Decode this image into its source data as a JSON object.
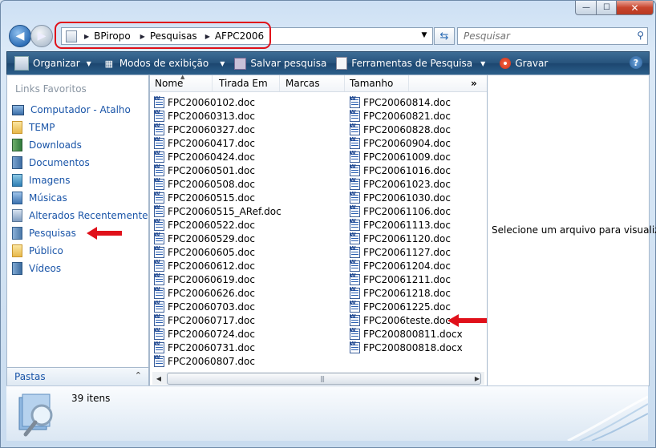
{
  "window": {
    "minimize_label": "—",
    "maximize_label": "☐",
    "close_label": "✕"
  },
  "address": {
    "crumbs": [
      "BPiropo",
      "Pesquisas",
      "AFPC2006"
    ]
  },
  "search": {
    "placeholder": "Pesquisar"
  },
  "toolbar": {
    "items": [
      {
        "label": "Organizar",
        "icon": "organize-icon",
        "has_dropdown": true
      },
      {
        "label": "Modos de exibição",
        "icon": "views-icon",
        "has_dropdown": true
      },
      {
        "label": "Salvar pesquisa",
        "icon": "save-icon",
        "has_dropdown": false
      },
      {
        "label": "Ferramentas de Pesquisa",
        "icon": "search-tools-icon",
        "has_dropdown": true
      },
      {
        "label": "Gravar",
        "icon": "burn-icon",
        "has_dropdown": false
      }
    ],
    "help_label": "?"
  },
  "nav": {
    "title": "Links Favoritos",
    "links": [
      {
        "label": "Computador - Atalho",
        "icon": "computer-icon"
      },
      {
        "label": "TEMP",
        "icon": "folder-icon"
      },
      {
        "label": "Downloads",
        "icon": "downloads-icon"
      },
      {
        "label": "Documentos",
        "icon": "documents-icon"
      },
      {
        "label": "Imagens",
        "icon": "pictures-icon"
      },
      {
        "label": "Músicas",
        "icon": "music-icon"
      },
      {
        "label": "Alterados Recentemente",
        "icon": "recent-icon"
      },
      {
        "label": "Pesquisas",
        "icon": "searches-icon"
      },
      {
        "label": "Público",
        "icon": "folder-icon"
      },
      {
        "label": "Vídeos",
        "icon": "videos-icon"
      }
    ],
    "folders_label": "Pastas",
    "folders_chevron": "⌃"
  },
  "columns": [
    "Nome",
    "Tirada Em",
    "Marcas",
    "Tamanho"
  ],
  "more_columns": "»",
  "files_col1": [
    "FPC20060102.doc",
    "FPC20060313.doc",
    "FPC20060327.doc",
    "FPC20060417.doc",
    "FPC20060424.doc",
    "FPC20060501.doc",
    "FPC20060508.doc",
    "FPC20060515.doc",
    "FPC20060515_ARef.doc",
    "FPC20060522.doc",
    "FPC20060529.doc",
    "FPC20060605.doc",
    "FPC20060612.doc",
    "FPC20060619.doc",
    "FPC20060626.doc",
    "FPC20060703.doc",
    "FPC20060717.doc",
    "FPC20060724.doc",
    "FPC20060731.doc",
    "FPC20060807.doc"
  ],
  "files_col2": [
    "FPC20060814.doc",
    "FPC20060821.doc",
    "FPC20060828.doc",
    "FPC20060904.doc",
    "FPC20061009.doc",
    "FPC20061016.doc",
    "FPC20061023.doc",
    "FPC20061030.doc",
    "FPC20061106.doc",
    "FPC20061113.doc",
    "FPC20061120.doc",
    "FPC20061127.doc",
    "FPC20061204.doc",
    "FPC20061211.doc",
    "FPC20061218.doc",
    "FPC20061225.doc",
    "FPC2006teste.doc",
    "FPC200800811.docx",
    "FPC200800818.docx"
  ],
  "preview": {
    "message": "Selecione um arquivo para visualizar."
  },
  "details": {
    "count": "39 itens"
  },
  "colors": {
    "highlight_red": "#e0101a",
    "link_blue": "#1a55a8",
    "toolbar_blue": "#26527b"
  }
}
